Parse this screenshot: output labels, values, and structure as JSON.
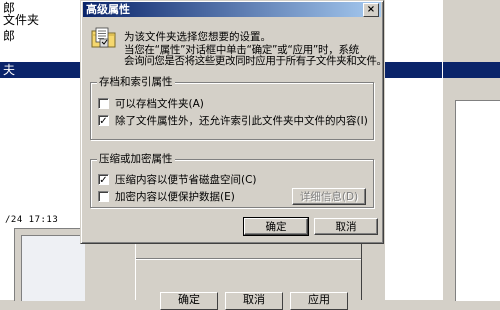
{
  "background": {
    "left_items": [
      "郎",
      "文件夹",
      "郎",
      "",
      "夫"
    ],
    "left_selected_index": 4,
    "left_timestamp": "/24 17:13",
    "buttons": [
      "确定",
      "取消",
      "应用"
    ]
  },
  "dialog": {
    "title": "高级属性",
    "close_glyph": "×",
    "description": [
      "为该文件夹选择您想要的设置。",
      "当您在“属性”对话框中单击“确定”或“应用”时，系统",
      "会询问您是否将这些更改同时应用于所有子文件夹和文件。"
    ],
    "archive_group": {
      "title": "存档和索引属性",
      "options": [
        {
          "label": "可以存档文件夹(A)",
          "checked": false
        },
        {
          "label": "除了文件属性外，还允许索引此文件夹中文件的内容(I)",
          "checked": true
        }
      ]
    },
    "compress_group": {
      "title": "压缩或加密属性",
      "options": [
        {
          "label": "压缩内容以便节省磁盘空间(C)",
          "checked": true
        },
        {
          "label": "加密内容以便保护数据(E)",
          "checked": false
        }
      ],
      "details_button": "详细信息(D)"
    },
    "ok_button": "确定",
    "cancel_button": "取消"
  },
  "colors": {
    "window_face": "#d4d0c8",
    "title_start": "#0a246a",
    "title_end": "#a6caf0",
    "selection": "#0a246a"
  },
  "icons": {
    "folder": "folder-properties-icon",
    "close": "close-icon",
    "check": "checkmark-icon"
  }
}
